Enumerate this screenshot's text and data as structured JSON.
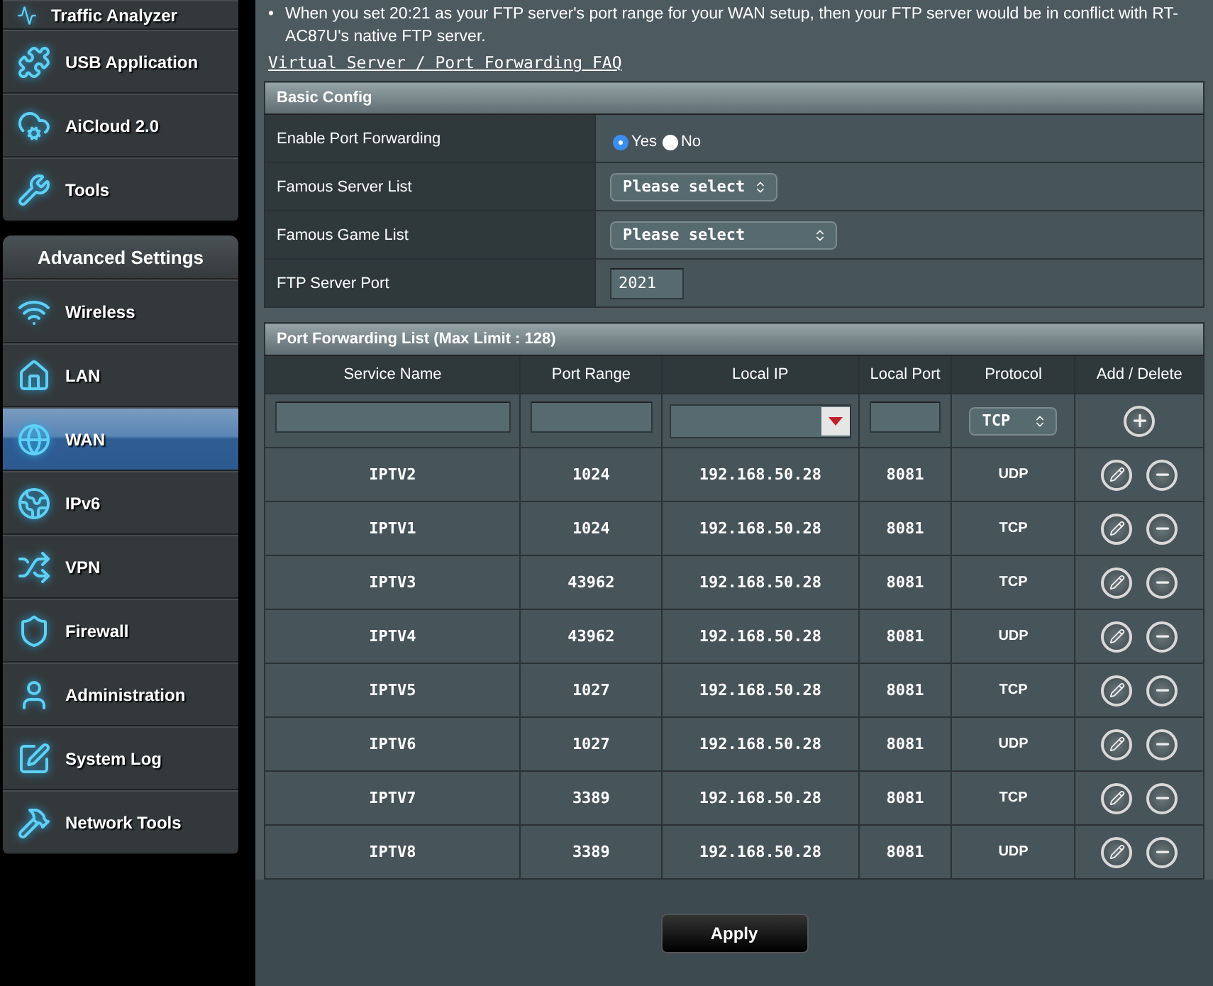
{
  "sidebar": {
    "top_items": [
      {
        "label": "Traffic Analyzer",
        "selected": false
      },
      {
        "label": "USB Application",
        "selected": false
      },
      {
        "label": "AiCloud 2.0",
        "selected": false
      },
      {
        "label": "Tools",
        "selected": false
      }
    ],
    "section_title": "Advanced Settings",
    "items": [
      {
        "label": "Wireless",
        "selected": false
      },
      {
        "label": "LAN",
        "selected": false
      },
      {
        "label": "WAN",
        "selected": true
      },
      {
        "label": "IPv6",
        "selected": false
      },
      {
        "label": "VPN",
        "selected": false
      },
      {
        "label": "Firewall",
        "selected": false
      },
      {
        "label": "Administration",
        "selected": false
      },
      {
        "label": "System Log",
        "selected": false
      },
      {
        "label": "Network Tools",
        "selected": false
      }
    ]
  },
  "notes": [
    {
      "bullet": "•",
      "text": "When you set 20:21 as your FTP server's port range for your WAN setup, then your FTP server would be in conflict with RT-AC87U's native FTP server."
    }
  ],
  "faq_link": "Virtual Server / Port Forwarding FAQ",
  "basic_config": {
    "title": "Basic Config",
    "rows": [
      {
        "label": "Enable Port Forwarding",
        "kind": "radio",
        "options": [
          {
            "label": "Yes",
            "selected": true
          },
          {
            "label": "No",
            "selected": false
          }
        ]
      },
      {
        "label": "Famous Server List",
        "kind": "select",
        "value": "Please select",
        "wide": false
      },
      {
        "label": "Famous Game List",
        "kind": "select",
        "value": "Please select",
        "wide": true
      },
      {
        "label": "FTP Server Port",
        "kind": "input",
        "value": "2021"
      }
    ]
  },
  "port_list": {
    "title": "Port Forwarding List (Max Limit : 128)",
    "columns": [
      "Service Name",
      "Port Range",
      "Local IP",
      "Local Port",
      "Protocol",
      "Add / Delete"
    ],
    "new_entry": {
      "protocol": "TCP"
    },
    "rows": [
      {
        "service_name": "IPTV2",
        "port_range": "1024",
        "local_ip": "192.168.50.28",
        "local_port": "8081",
        "protocol": "UDP"
      },
      {
        "service_name": "IPTV1",
        "port_range": "1024",
        "local_ip": "192.168.50.28",
        "local_port": "8081",
        "protocol": "TCP"
      },
      {
        "service_name": "IPTV3",
        "port_range": "43962",
        "local_ip": "192.168.50.28",
        "local_port": "8081",
        "protocol": "TCP"
      },
      {
        "service_name": "IPTV4",
        "port_range": "43962",
        "local_ip": "192.168.50.28",
        "local_port": "8081",
        "protocol": "UDP"
      },
      {
        "service_name": "IPTV5",
        "port_range": "1027",
        "local_ip": "192.168.50.28",
        "local_port": "8081",
        "protocol": "TCP"
      },
      {
        "service_name": "IPTV6",
        "port_range": "1027",
        "local_ip": "192.168.50.28",
        "local_port": "8081",
        "protocol": "UDP"
      },
      {
        "service_name": "IPTV7",
        "port_range": "3389",
        "local_ip": "192.168.50.28",
        "local_port": "8081",
        "protocol": "TCP"
      },
      {
        "service_name": "IPTV8",
        "port_range": "3389",
        "local_ip": "192.168.50.28",
        "local_port": "8081",
        "protocol": "UDP"
      }
    ]
  },
  "apply_button": "Apply"
}
